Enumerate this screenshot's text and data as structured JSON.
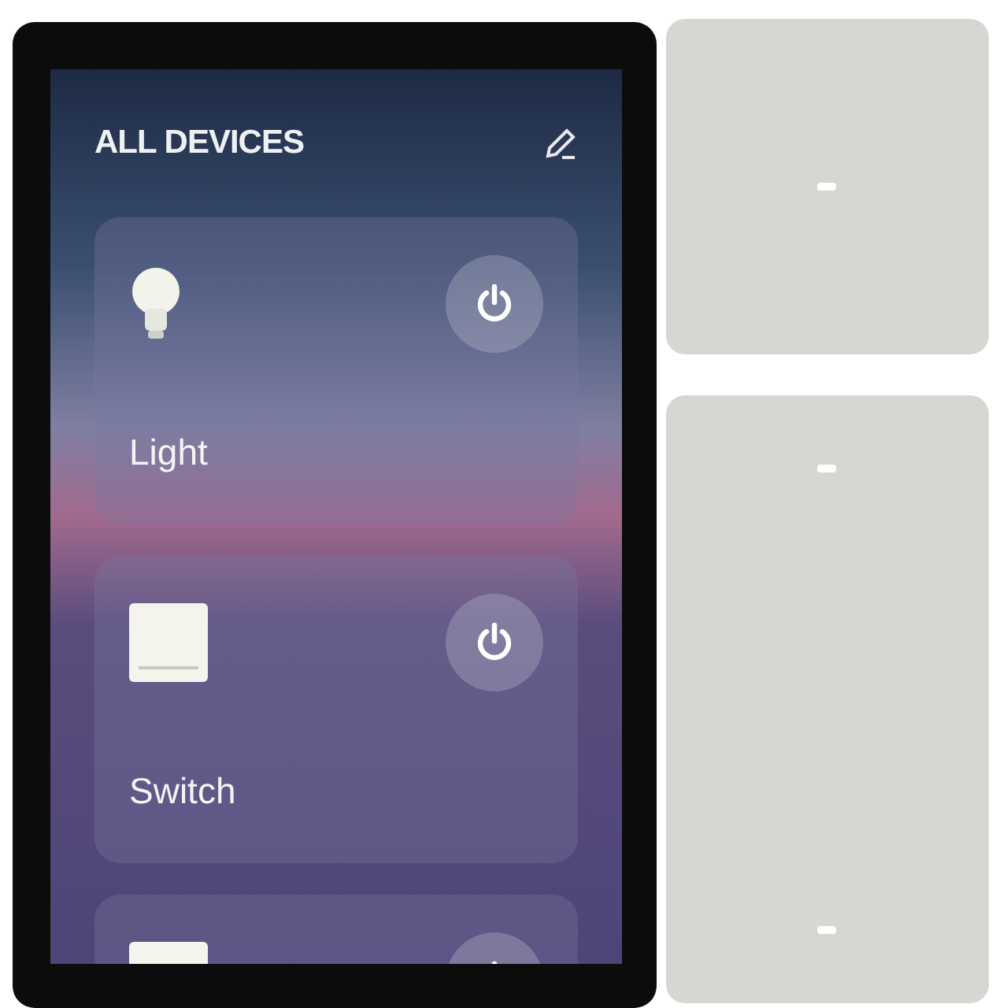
{
  "header": {
    "title": "ALL DEVICES"
  },
  "devices": [
    {
      "kind": "light",
      "name": "Light"
    },
    {
      "kind": "switch",
      "name": "Switch"
    },
    {
      "kind": "switch"
    }
  ]
}
